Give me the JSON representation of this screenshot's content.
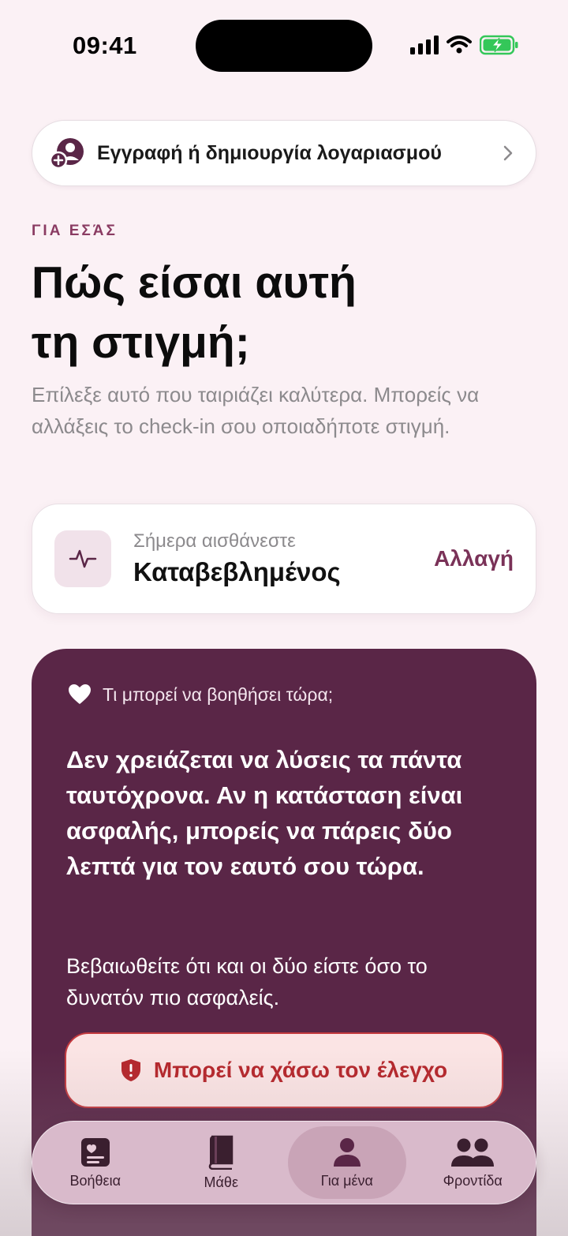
{
  "status_bar": {
    "time": "09:41"
  },
  "account": {
    "label": "Εγγραφή ή δημιουργία λογαριασμού"
  },
  "hero": {
    "eyebrow": "ΓΙΑ ΕΣΆΣ",
    "title_line1": "Πώς είσαι αυτή",
    "title_line2": "τη στιγμή;",
    "subtitle": "Επίλεξε αυτό που ταιριάζει καλύτερα. Μπορείς να αλλάξεις το check-in σου οποιαδήποτε στιγμή."
  },
  "feeling": {
    "caption": "Σήμερα αισθάνεστε",
    "value": "Καταβεβλημένος",
    "change": "Αλλαγή"
  },
  "help_card": {
    "title": "Τι μπορεί να βοηθήσει τώρα;",
    "main_text": "Δεν χρειάζεται να λύσεις τα πάντα ταυτόχρονα. Αν η κατάσταση είναι ασφαλής, μπορείς να πάρεις δύο λεπτά για τον εαυτό σου τώρα.",
    "note": "Βεβαιωθείτε ότι και οι δύο είστε όσο το δυνατόν πιο ασφαλείς.",
    "danger_button": "Μπορεί να χάσω τον έλεγχο"
  },
  "tab_bar": {
    "items": [
      {
        "label": "Βοήθεια",
        "icon": "help-card-icon",
        "active": false
      },
      {
        "label": "Μάθε",
        "icon": "book-icon",
        "active": false
      },
      {
        "label": "Για μένα",
        "icon": "person-icon",
        "active": true
      },
      {
        "label": "Φροντίδα",
        "icon": "people-icon",
        "active": false
      }
    ]
  },
  "colors": {
    "background": "#fbf1f5",
    "accent": "#8a3b62",
    "card": "#5a2647",
    "danger": "#b5262b",
    "battery": "#34c759"
  }
}
